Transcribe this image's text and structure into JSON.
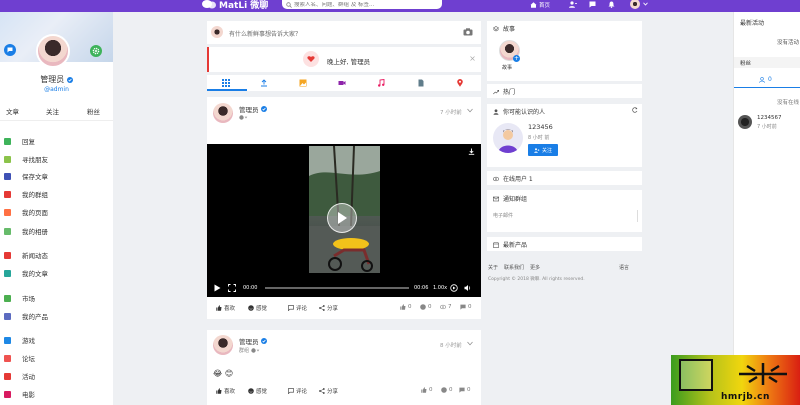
{
  "header": {
    "brand": "MatLi 微聊",
    "search_placeholder": "搜索人名、问题、群组 及 标签...",
    "home_label": "首页"
  },
  "profile": {
    "name": "管理员",
    "handle": "@admin",
    "stats": [
      "文章",
      "关注",
      "粉丝"
    ]
  },
  "nav": [
    {
      "label": "回复",
      "color": "#3eb35a"
    },
    {
      "label": "寻找朋友",
      "color": "#8bc34a"
    },
    {
      "label": "保存文章",
      "color": "#3f51b5"
    },
    {
      "label": "我的群组",
      "color": "#e53935"
    },
    {
      "label": "我的页面",
      "color": "#ff7043"
    },
    {
      "label": "我的相册",
      "color": "#66bb6a"
    },
    {
      "label": "新闻动态",
      "color": "#e53935"
    },
    {
      "label": "我的文章",
      "color": "#26a69a"
    },
    {
      "label": "市场",
      "color": "#4caf50"
    },
    {
      "label": "我的产品",
      "color": "#5c6bc0"
    },
    {
      "label": "游戏",
      "color": "#1e88e5"
    },
    {
      "label": "论坛",
      "color": "#ef5350"
    },
    {
      "label": "活动",
      "color": "#e53935"
    },
    {
      "label": "电影",
      "color": "#d81b60"
    }
  ],
  "composer": {
    "placeholder": "有什么新鲜事想告诉大家？",
    "greeting": "晚上好, 管理员"
  },
  "posts": [
    {
      "author": "管理员",
      "time": "7 小时前",
      "actions": [
        "喜欢",
        "评论",
        "分享"
      ],
      "react_label": "感觉",
      "player": {
        "current": "00:00",
        "duration": "00:06",
        "speed": "1.00x"
      },
      "counts": [
        "0",
        "0",
        "7",
        "0"
      ]
    },
    {
      "author": "管理员",
      "time": "8 小时前",
      "subtitle": "群组",
      "emoji": "😂 😊",
      "actions": [
        "喜欢",
        "评论",
        "分享"
      ],
      "react_label": "感觉",
      "counts": [
        "0",
        "0",
        "0",
        "0"
      ]
    }
  ],
  "right": {
    "story_title": "故事",
    "story_label": "故事",
    "trending_title": "热门",
    "suggest_title": "你可能认识的人",
    "suggest_name": "123456",
    "suggest_time": "8 小时 前",
    "follow_label": "关注",
    "online_title": "在线用户 1",
    "groups_title": "通知群组",
    "groups_sub": "电子邮件",
    "products_title": "最新产品",
    "footer_links": [
      "关于",
      "联系我们",
      "更多"
    ],
    "footer_lang": "语言",
    "copyright": "Copyright © 2018 微聊. All rights reserved."
  },
  "far_right": {
    "activity_title": "最新活动",
    "no_activity": "没有活动",
    "followers_title": "粉丝",
    "followers_count": "0",
    "online_label": "没有在线",
    "user_name": "1234567",
    "user_time": "7 小时前"
  },
  "watermark": "hmrjb.cn"
}
